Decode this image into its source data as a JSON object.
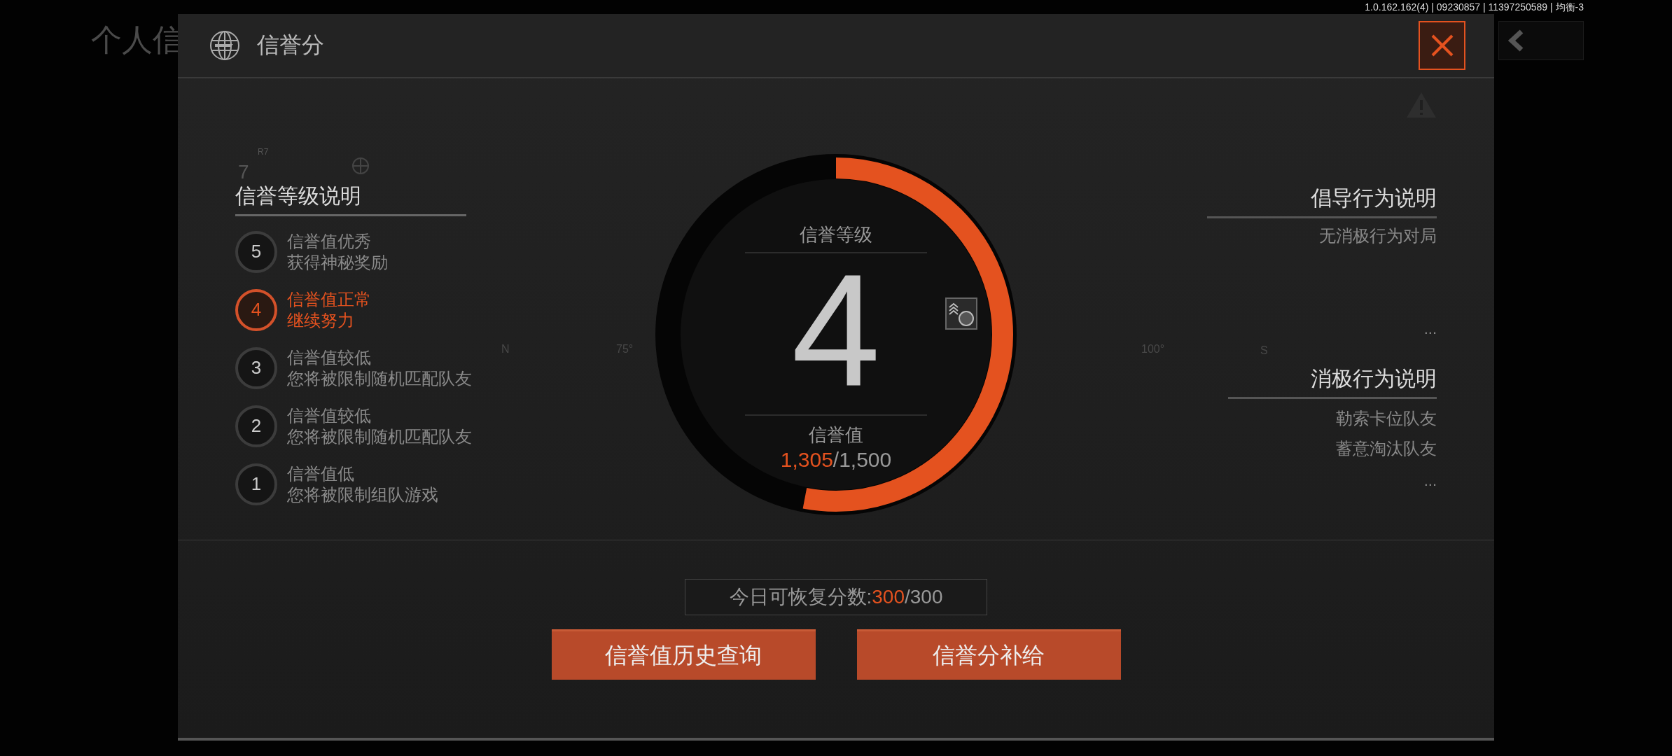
{
  "background_title": "个人信",
  "version_info": "1.0.162.162(4) | 09230857 | 11397250589 | 均衡-3",
  "dialog": {
    "title": "信誉分"
  },
  "decor_labels": [
    "R7",
    "7"
  ],
  "compass_labels": [
    "N",
    "75°",
    "100°",
    "S"
  ],
  "levels": {
    "heading": "信誉等级说明",
    "items": [
      {
        "number": "5",
        "title": "信誉值优秀",
        "description": "获得神秘奖励",
        "selected": false
      },
      {
        "number": "4",
        "title": "信誉值正常",
        "description": "继续努力",
        "selected": true
      },
      {
        "number": "3",
        "title": "信誉值较低",
        "description": "您将被限制随机匹配队友",
        "selected": false
      },
      {
        "number": "2",
        "title": "信誉值较低",
        "description": "您将被限制随机匹配队友",
        "selected": false
      },
      {
        "number": "1",
        "title": "信誉值低",
        "description": "您将被限制组队游戏",
        "selected": false
      }
    ]
  },
  "gauge": {
    "label": "信誉等级",
    "level_number": "4",
    "level": 0.53,
    "value_label": "信誉值",
    "current": "1,305",
    "max": "/1,500"
  },
  "encouraged": {
    "heading": "倡导行为说明",
    "items": [
      "无消极行为对局"
    ],
    "more": "..."
  },
  "negative": {
    "heading": "消极行为说明",
    "items": [
      "勒索卡位队友",
      "蓄意淘汰队友"
    ],
    "more": "..."
  },
  "recovery": {
    "label": "今日可恢复分数:",
    "current": "300",
    "max": "/300"
  },
  "buttons": [
    "信誉值历史查询",
    "信誉分补给"
  ]
}
